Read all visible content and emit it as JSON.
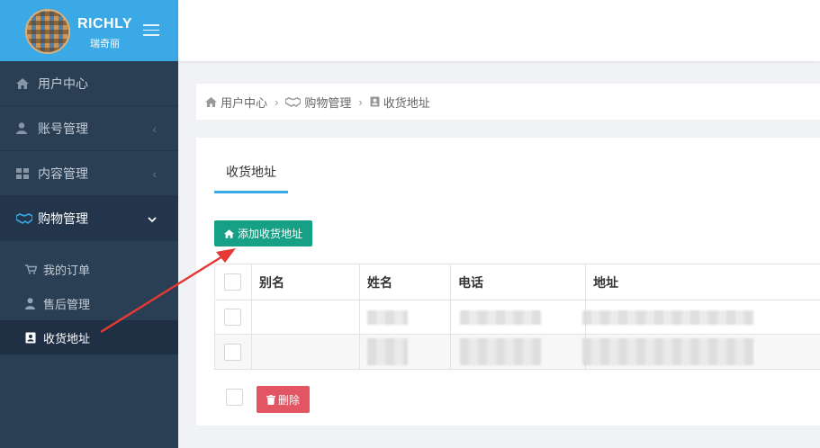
{
  "brand": {
    "title": "RICHLY",
    "subtitle": "瑞奇丽"
  },
  "sidebar": {
    "items": [
      {
        "label": "用户中心",
        "icon": "home-icon"
      },
      {
        "label": "账号管理",
        "icon": "user-icon"
      },
      {
        "label": "内容管理",
        "icon": "grid-icon"
      },
      {
        "label": "购物管理",
        "icon": "handshake-icon"
      }
    ],
    "sub_items": [
      {
        "label": "我的订单",
        "icon": "cart-icon"
      },
      {
        "label": "售后管理",
        "icon": "user-tie-icon"
      },
      {
        "label": "收货地址",
        "icon": "address-book-icon"
      }
    ]
  },
  "breadcrumb": {
    "items": [
      "用户中心",
      "购物管理",
      "收货地址"
    ]
  },
  "tab": {
    "label": "收货地址"
  },
  "toolbar": {
    "add_label": "添加收货地址",
    "delete_label": "删除"
  },
  "table": {
    "headers": [
      "别名",
      "姓名",
      "电话",
      "地址"
    ],
    "rows": [
      {
        "alias": "",
        "name": "",
        "phone": "",
        "address": ""
      },
      {
        "alias": "",
        "name": "",
        "phone": "",
        "address": ""
      }
    ]
  },
  "colors": {
    "sidebar": "#2a3f54",
    "brand": "#3aa9e6",
    "add_button": "#16a085",
    "delete_button": "#e25563",
    "annotation": "#e53935"
  }
}
